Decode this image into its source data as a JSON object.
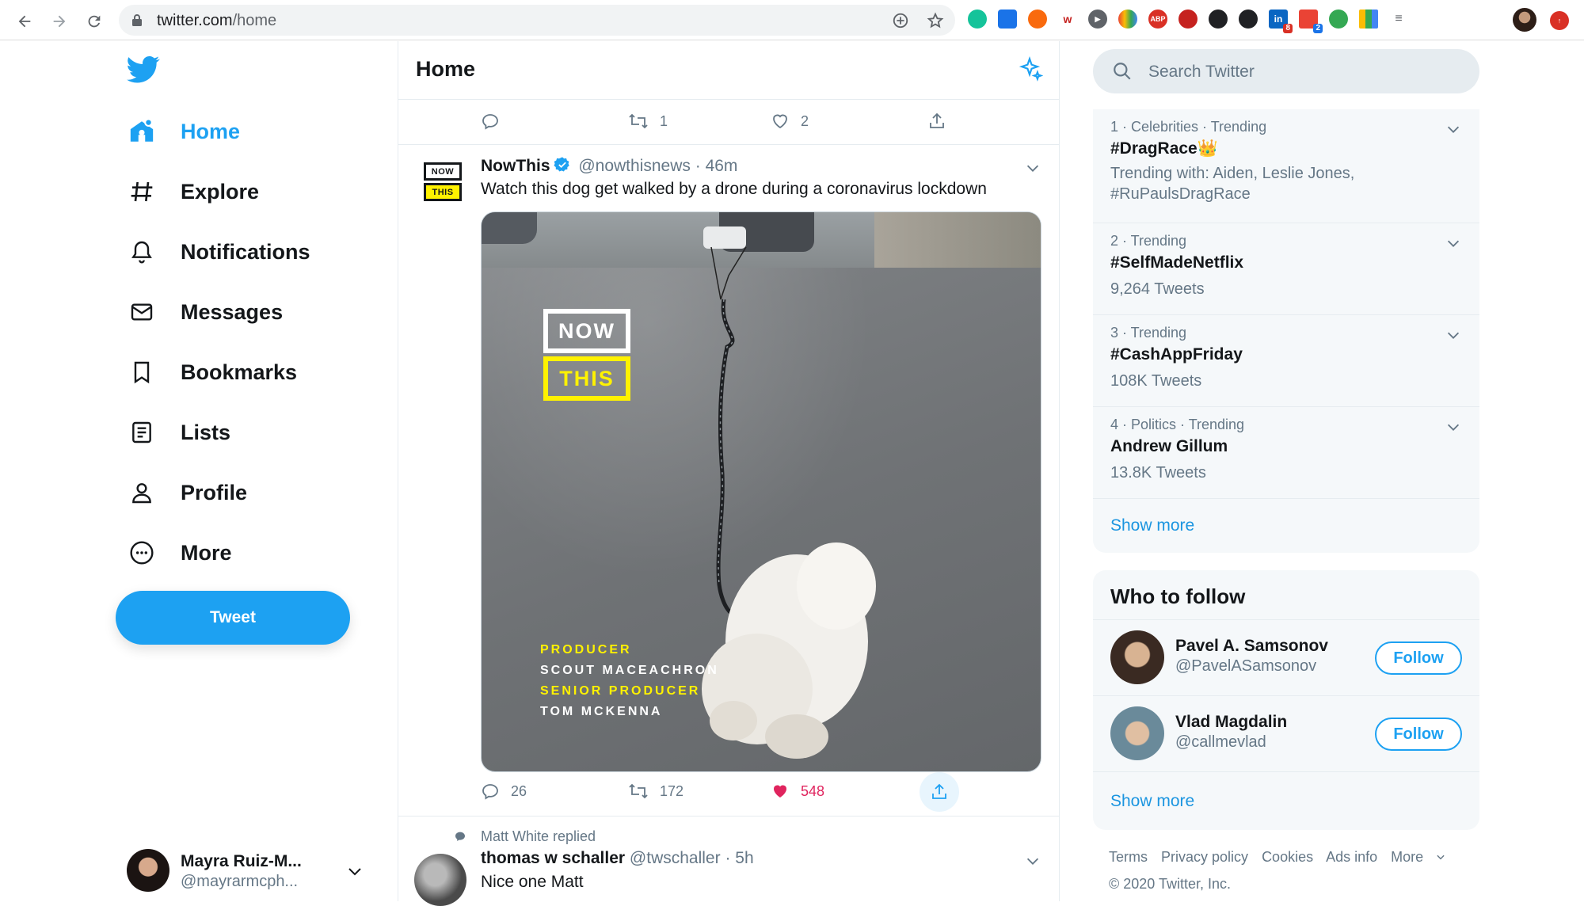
{
  "browser": {
    "url_host": "twitter.com",
    "url_path": "/home",
    "extension_badges": [
      "8",
      "2"
    ],
    "extension_abp": "ABP"
  },
  "sidebar": {
    "items": [
      {
        "label": "Home",
        "icon": "home-icon"
      },
      {
        "label": "Explore",
        "icon": "hashtag-icon"
      },
      {
        "label": "Notifications",
        "icon": "bell-icon"
      },
      {
        "label": "Messages",
        "icon": "envelope-icon"
      },
      {
        "label": "Bookmarks",
        "icon": "bookmark-icon"
      },
      {
        "label": "Lists",
        "icon": "list-icon"
      },
      {
        "label": "Profile",
        "icon": "person-icon"
      },
      {
        "label": "More",
        "icon": "more-icon"
      }
    ],
    "tweet_button": "Tweet",
    "account": {
      "name": "Mayra Ruiz-M...",
      "handle": "@mayrarmcph..."
    }
  },
  "timeline": {
    "title": "Home",
    "prev_tweet": {
      "retweets": "1",
      "likes": "2"
    },
    "tweet": {
      "logo_top": "NOW",
      "logo_bottom": "THIS",
      "name": "NowThis",
      "handle": "@nowthisnews",
      "time": "46m",
      "text": "Watch this dog get walked by a drone during a coronavirus lockdown",
      "media": {
        "brand_top": "NOW",
        "brand_bottom": "THIS",
        "credits": [
          {
            "text": "PRODUCER",
            "color": "#fff200"
          },
          {
            "text": "SCOUT MACEACHRON",
            "color": "#ffffff"
          },
          {
            "text": "SENIOR PRODUCER",
            "color": "#fff200"
          },
          {
            "text": "TOM MCKENNA",
            "color": "#ffffff"
          }
        ]
      },
      "replies": "26",
      "retweets": "172",
      "likes": "548"
    },
    "reply_tweet": {
      "context": "Matt White replied",
      "name": "thomas w schaller",
      "handle": "@twschaller",
      "time": "5h",
      "text": "Nice one Matt"
    }
  },
  "search": {
    "placeholder": "Search Twitter"
  },
  "trends": [
    {
      "meta": "1 · Celebrities · Trending",
      "title": "#DragRace👑",
      "sub": "Trending with: Aiden, Leslie Jones, #RuPaulsDragRace"
    },
    {
      "meta": "2 · Trending",
      "title": "#SelfMadeNetflix",
      "sub": "9,264 Tweets"
    },
    {
      "meta": "3 · Trending",
      "title": "#CashAppFriday",
      "sub": "108K Tweets"
    },
    {
      "meta": "4 · Politics · Trending",
      "title": "Andrew Gillum",
      "sub": "13.8K Tweets"
    }
  ],
  "trends_show_more": "Show more",
  "who_to_follow": {
    "title": "Who to follow",
    "users": [
      {
        "name": "Pavel A. Samsonov",
        "handle": "@PavelASamsonov",
        "button": "Follow"
      },
      {
        "name": "Vlad Magdalin",
        "handle": "@callmevlad",
        "button": "Follow"
      }
    ],
    "show_more": "Show more"
  },
  "footer": {
    "links": [
      "Terms",
      "Privacy policy",
      "Cookies",
      "Ads info",
      "More"
    ],
    "copyright": "© 2020 Twitter, Inc."
  },
  "colors": {
    "accent": "#1da1f2",
    "like": "#e0245e",
    "muted": "#657786"
  }
}
